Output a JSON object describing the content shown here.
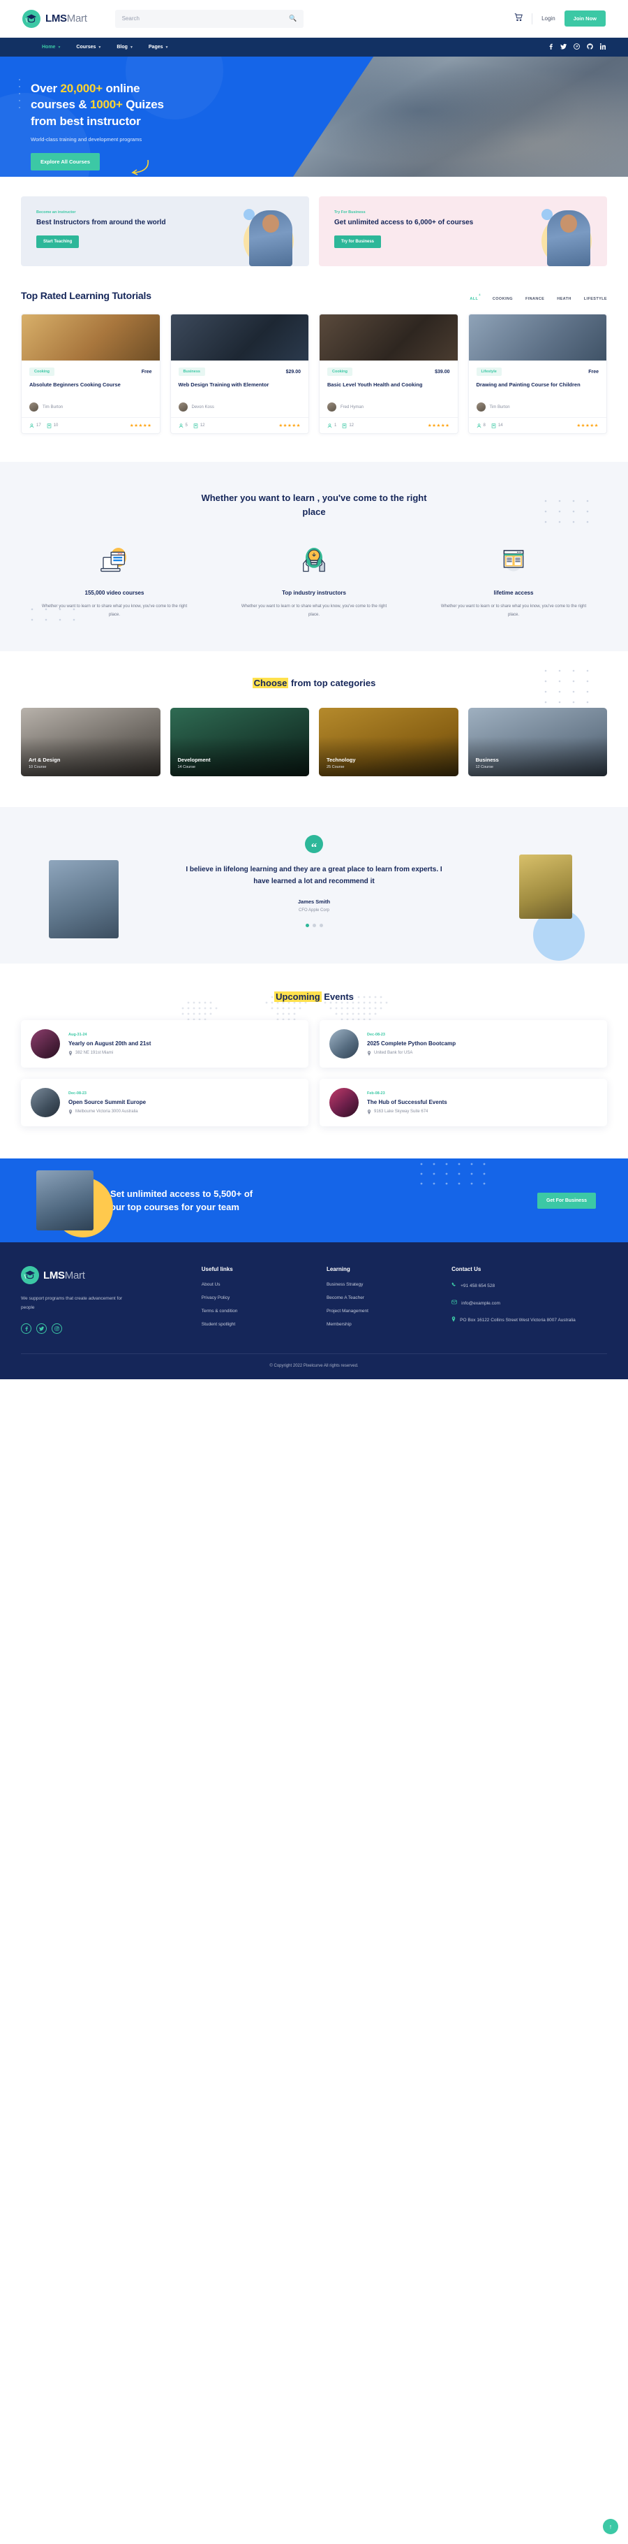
{
  "brand": {
    "name_bold": "LMS",
    "name_light": "Mart"
  },
  "header": {
    "search": {
      "placeholder": "Search",
      "value": "",
      "icon": "search-icon"
    },
    "cart_icon": "cart-icon",
    "login_label": "Login",
    "join_label": "Join Now"
  },
  "nav": {
    "items": [
      {
        "label": "Home",
        "active": true
      },
      {
        "label": "Courses",
        "active": false
      },
      {
        "label": "Blog",
        "active": false
      },
      {
        "label": "Pages",
        "active": false
      }
    ],
    "social": [
      {
        "name": "facebook-icon",
        "glyph": "f"
      },
      {
        "name": "twitter-icon",
        "glyph": "🐦"
      },
      {
        "name": "pinterest-icon",
        "glyph": "P"
      },
      {
        "name": "github-icon",
        "glyph": "G"
      },
      {
        "name": "linkedin-icon",
        "glyph": "in"
      }
    ]
  },
  "hero": {
    "line1_pre": "Over ",
    "line1_hl": "20,000+",
    "line1_post": " online",
    "line2_pre": "courses & ",
    "line2_hl": "1000+",
    "line2_post": " Quizes",
    "line3": "from best instructor",
    "subtitle": "World-class training and development programs",
    "cta": "Explore All Courses"
  },
  "promos": [
    {
      "eyebrow": "Become an instructor",
      "title": "Best Instructors from around the world",
      "button": "Start Teaching"
    },
    {
      "eyebrow": "Try For Business",
      "title": "Get unlimited access to 6,000+ of courses",
      "button": "Try for Business"
    }
  ],
  "courses_section": {
    "title": "Top Rated Learning Tutorials",
    "filters": [
      {
        "label": "ALL",
        "count": "4",
        "active": true
      },
      {
        "label": "COOKING",
        "count": "",
        "active": false
      },
      {
        "label": "FINANCE",
        "count": "",
        "active": false
      },
      {
        "label": "HEATH",
        "count": "",
        "active": false
      },
      {
        "label": "LIFESTYLE",
        "count": "",
        "active": false
      }
    ],
    "cards": [
      {
        "badge": "Cooking",
        "price": "Free",
        "title": "Absolute Beginners Cooking Course",
        "author": "Tim Burton",
        "students": "17",
        "lessons": "10",
        "stars": "★★★★★"
      },
      {
        "badge": "Business",
        "price": "$29.00",
        "title": "Web Design Training with Elementor",
        "author": "Devon Koss",
        "students": "5",
        "lessons": "12",
        "stars": "★★★★★"
      },
      {
        "badge": "Cooking",
        "price": "$39.00",
        "title": "Basic Level Youth Health and Cooking",
        "author": "Fred Hyman",
        "students": "1",
        "lessons": "12",
        "stars": "★★★★★"
      },
      {
        "badge": "Lifestyle",
        "price": "Free",
        "title": "Drawing and Painting Course for Children",
        "author": "Tim Burton",
        "students": "8",
        "lessons": "14",
        "stars": "★★★★★"
      }
    ]
  },
  "learn_section": {
    "heading": "Whether you want to learn , you've come to the right place",
    "features": [
      {
        "icon": "laptop-icon",
        "title": "155,000 video courses",
        "desc": "Whether you want to learn or to share what you know, you've come to the right place."
      },
      {
        "icon": "lightbulb-icon",
        "title": "Top industry instructors",
        "desc": "Whether you want to learn or to share what you know, you've come to the right place."
      },
      {
        "icon": "book-icon",
        "title": "lifetime access",
        "desc": "Whether you want to learn or to share what you know, you've come to the right place."
      }
    ]
  },
  "categories_section": {
    "heading_hl": "Choose",
    "heading_rest": " from top categories",
    "items": [
      {
        "name": "Art & Design",
        "count": "10 Course"
      },
      {
        "name": "Development",
        "count": "14 Course"
      },
      {
        "name": "Technology",
        "count": "25 Course"
      },
      {
        "name": "Business",
        "count": "12 Course"
      }
    ]
  },
  "testimonial": {
    "quote_icon": "quote-icon",
    "quote": "I believe in lifelong learning and they are a great place to learn from experts. I have learned a lot and recommend it",
    "name": "James Smith",
    "role": "CFO Apple Corp",
    "slides": 3,
    "active_slide": 0
  },
  "events_section": {
    "heading_hl": "Upcoming",
    "heading_rest": " Events",
    "events": [
      {
        "date": "Aug-31-24",
        "title": "Yearly on August 20th and 21st",
        "location": "382 NE 191st Miami"
      },
      {
        "date": "Dec-08-23",
        "title": "2025 Complete Python Bootcamp",
        "location": "United Bank for USA"
      },
      {
        "date": "Dec-08-23",
        "title": "Open Source Summit Europe",
        "location": "Melbourne Victoria 3000 Australia"
      },
      {
        "date": "Feb-08-23",
        "title": "The Hub of Successful Events",
        "location": "9163 Lake Skyway Suite 674"
      }
    ]
  },
  "cta": {
    "line1": "Set unlimited access to 5,500+ of",
    "line2": "our top courses for your team",
    "button": "Get For Business"
  },
  "footer": {
    "about": "We support programs that create advancement for people",
    "social": [
      {
        "name": "facebook-icon",
        "glyph": "f"
      },
      {
        "name": "twitter-icon",
        "glyph": "t"
      },
      {
        "name": "instagram-icon",
        "glyph": "◎"
      }
    ],
    "columns": [
      {
        "heading": "Useful links",
        "links": [
          "About Us",
          "Privacy Policy",
          "Terms & condition",
          "Student spotlight"
        ]
      },
      {
        "heading": "Learning",
        "links": [
          "Business Strategy",
          "Become A Teacher",
          "Project Management",
          "Membership"
        ]
      }
    ],
    "contact": {
      "heading": "Contact Us",
      "phone": "+91 458 654 528",
      "email": "info@example.com",
      "address": "PO Box 16122 Collins Street West Victoria 8007 Australia"
    },
    "copyright": "© Copyright 2022 Pixelcurve All rights reserved."
  },
  "back_to_top": "back-to-top-icon",
  "colors": {
    "primary_blue": "#1565e8",
    "navy": "#152659",
    "green": "#3cc8a5",
    "yellow": "#ffd42e"
  }
}
